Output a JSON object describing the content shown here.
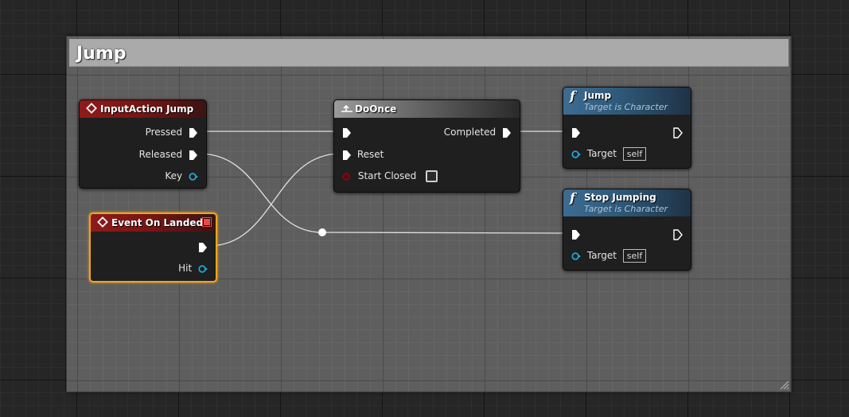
{
  "comment": {
    "title": "Jump"
  },
  "nodes": {
    "input_action": {
      "title": "InputAction Jump",
      "pins": {
        "pressed": "Pressed",
        "released": "Released",
        "key": "Key"
      }
    },
    "event_landed": {
      "title": "Event On Landed",
      "pins": {
        "hit": "Hit"
      }
    },
    "do_once": {
      "title": "DoOnce",
      "pins": {
        "completed": "Completed",
        "reset": "Reset",
        "start_closed": "Start Closed"
      }
    },
    "jump": {
      "title": "Jump",
      "subtitle": "Target is Character",
      "pins": {
        "target": "Target",
        "target_value": "self"
      }
    },
    "stop_jumping": {
      "title": "Stop Jumping",
      "subtitle": "Target is Character",
      "pins": {
        "target": "Target",
        "target_value": "self"
      }
    }
  },
  "colors": {
    "event_header": "#8e1b1b",
    "function_header": "#3d6c93",
    "macro_header": "#9a9a9a",
    "selection": "#f3a41c",
    "object_pin": "#1fa9e0",
    "bool_pin": "#8a0a0a",
    "wire": "#e0e0e0"
  },
  "icons": {
    "event": "event-diamond-icon",
    "function": "function-f-icon",
    "macro": "macro-icon",
    "exec": "exec-pin-icon",
    "object": "object-pin-icon",
    "bool": "bool-pin-icon",
    "reroute": "reroute-knot-icon"
  }
}
